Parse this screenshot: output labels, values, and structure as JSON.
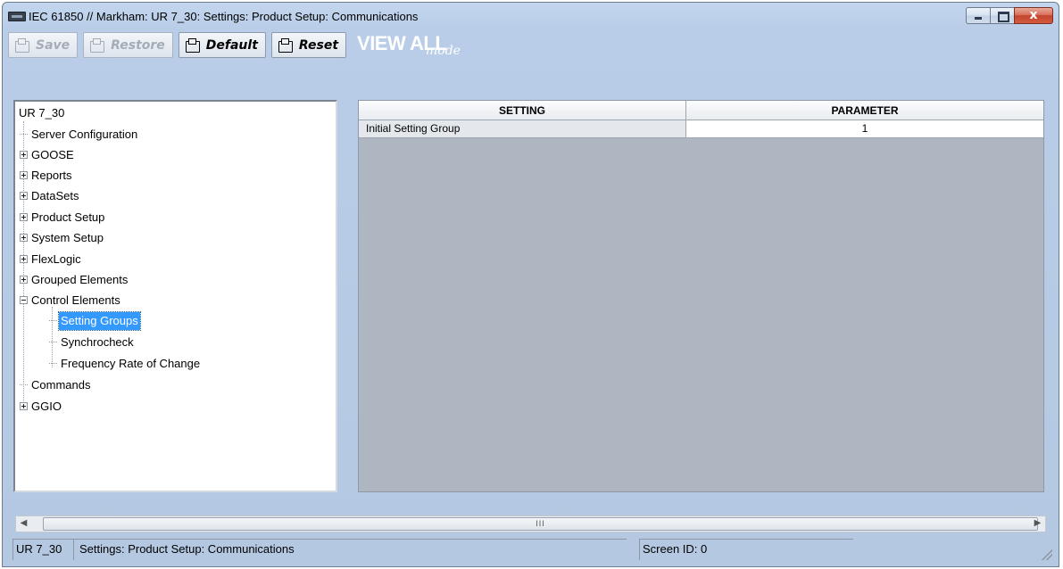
{
  "window": {
    "title": "IEC 61850 // Markham: UR 7_30: Settings: Product Setup: Communications",
    "close_glyph": "x"
  },
  "toolbar": {
    "save_label": "Save",
    "restore_label": "Restore",
    "default_label": "Default",
    "reset_label": "Reset",
    "view_all_label": "VIEW ALL",
    "view_all_mode": "mode"
  },
  "tree": {
    "root": "UR 7_30",
    "items": [
      {
        "label": "Server Configuration",
        "expander": "none",
        "level": 1
      },
      {
        "label": "GOOSE",
        "expander": "plus",
        "level": 1
      },
      {
        "label": "Reports",
        "expander": "plus",
        "level": 1
      },
      {
        "label": "DataSets",
        "expander": "plus",
        "level": 1
      },
      {
        "label": "Product Setup",
        "expander": "plus",
        "level": 1
      },
      {
        "label": "System Setup",
        "expander": "plus",
        "level": 1
      },
      {
        "label": "FlexLogic",
        "expander": "plus",
        "level": 1
      },
      {
        "label": "Grouped Elements",
        "expander": "plus",
        "level": 1
      },
      {
        "label": "Control Elements",
        "expander": "minus",
        "level": 1
      },
      {
        "label": "Setting Groups",
        "expander": "none",
        "level": 2,
        "selected": true
      },
      {
        "label": "Synchrocheck",
        "expander": "none",
        "level": 2
      },
      {
        "label": "Frequency Rate of Change",
        "expander": "none",
        "level": 2
      },
      {
        "label": "Commands",
        "expander": "none",
        "level": 1
      },
      {
        "label": "GGIO",
        "expander": "plus",
        "level": 1
      }
    ]
  },
  "grid": {
    "headers": {
      "setting": "SETTING",
      "parameter": "PARAMETER"
    },
    "rows": [
      {
        "setting": "Initial Setting Group",
        "parameter": "1"
      }
    ]
  },
  "scrollbar": {
    "left_arrow": "◀",
    "right_arrow": "▶",
    "thumb_grip": "III"
  },
  "status": {
    "device": "UR 7_30",
    "path": "Settings: Product Setup: Communications",
    "screen_id": "Screen ID: 0"
  },
  "colors": {
    "window_bg": "#b4c8e2",
    "selection": "#3399ff",
    "grid_bg": "#aeb6c1"
  }
}
